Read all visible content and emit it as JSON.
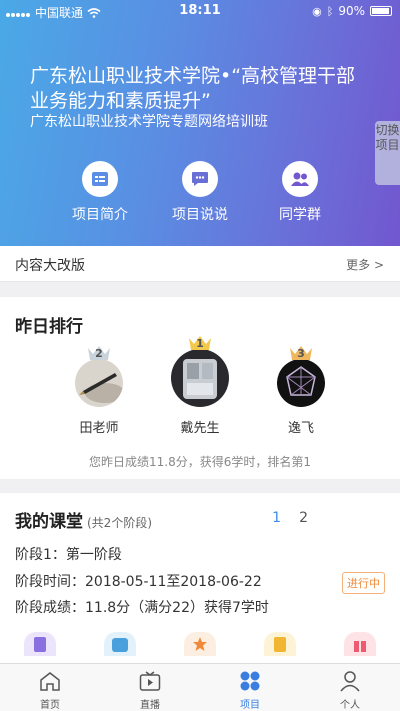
{
  "status_bar": {
    "carrier": "中国联通",
    "time": "18:11",
    "battery": "90%"
  },
  "hero": {
    "title": "广东松山职业技术学院•“高校管理干部业务能力和素质提升”",
    "subtitle": "广东松山职业技术学院专题网络培训班",
    "switch_label": "切换项目",
    "actions": [
      {
        "label": "项目简介",
        "icon": "document-icon"
      },
      {
        "label": "项目说说",
        "icon": "chat-icon"
      },
      {
        "label": "同学群",
        "icon": "group-icon"
      }
    ]
  },
  "notice": {
    "text": "内容大改版",
    "more": "更多 >"
  },
  "ranking": {
    "title": "昨日排行",
    "items": [
      {
        "rank": "2",
        "name": "田老师"
      },
      {
        "rank": "1",
        "name": "戴先生"
      },
      {
        "rank": "3",
        "name": "逸飞"
      }
    ],
    "summary": "您昨日成绩11.8分，获得6学时，排名第1"
  },
  "course": {
    "title": "我的课堂",
    "subtitle": "(共2个阶段)",
    "pages": [
      "1",
      "2"
    ],
    "stage": "阶段1：第一阶段",
    "time": "阶段时间：2018-05-11至2018-06-22",
    "score": "阶段成绩：11.8分（满分22）获得7学时",
    "status": "进行中"
  },
  "colors": {
    "accent": "#3a7fe0",
    "status_orange": "#f08a3a",
    "gradient_start": "#4aa9e6",
    "gradient_end": "#7257cf"
  },
  "tabbar": [
    {
      "label": "首页",
      "icon": "home-icon"
    },
    {
      "label": "直播",
      "icon": "tv-icon"
    },
    {
      "label": "项目",
      "icon": "grid-icon",
      "active": true
    },
    {
      "label": "个人",
      "icon": "person-icon"
    }
  ]
}
